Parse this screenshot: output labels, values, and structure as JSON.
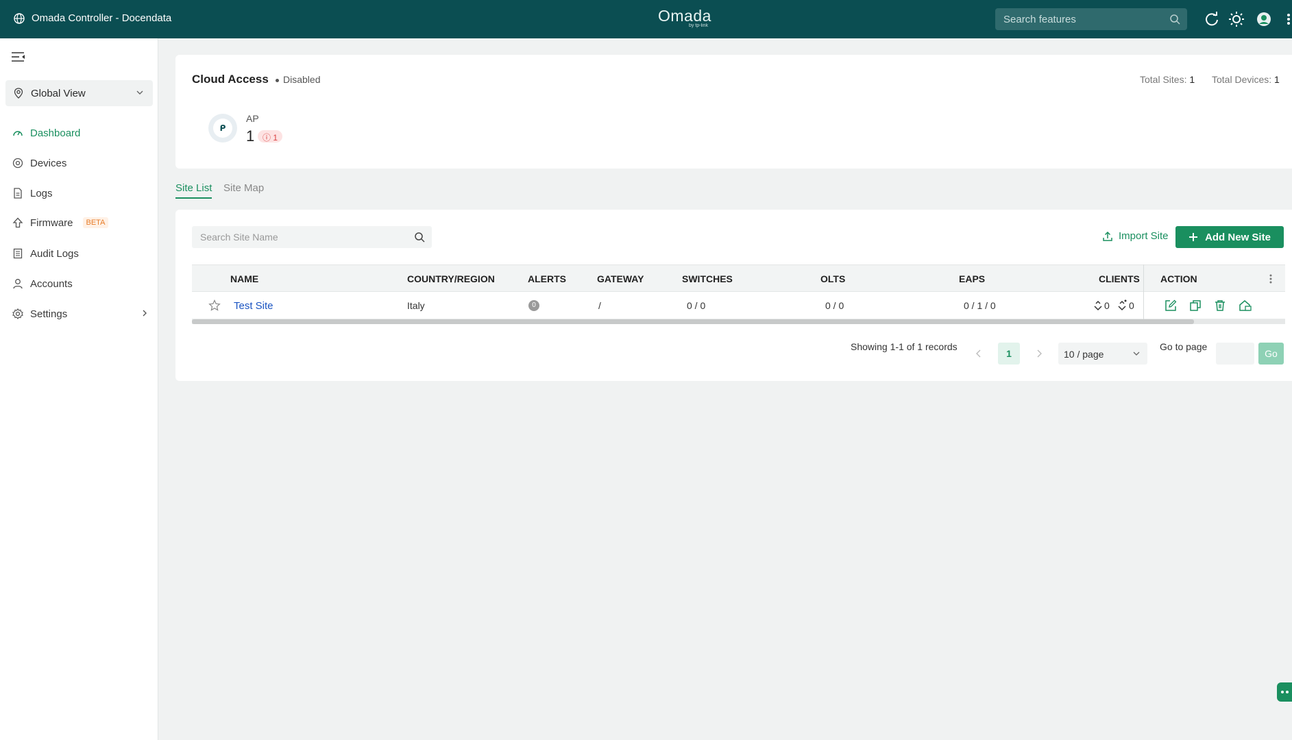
{
  "topbar": {
    "title": "Omada Controller - Docendata",
    "logo": "Omada",
    "logo_sub": "by tp-link",
    "search_placeholder": "Search features"
  },
  "sidebar": {
    "global_view": "Global View",
    "items": [
      {
        "label": "Dashboard",
        "icon": "dashboard-icon",
        "active": true
      },
      {
        "label": "Devices",
        "icon": "devices-icon"
      },
      {
        "label": "Logs",
        "icon": "logs-icon"
      },
      {
        "label": "Firmware",
        "icon": "firmware-icon",
        "badge": "BETA"
      },
      {
        "label": "Audit Logs",
        "icon": "audit-logs-icon"
      },
      {
        "label": "Accounts",
        "icon": "accounts-icon"
      },
      {
        "label": "Settings",
        "icon": "settings-icon",
        "has_submenu": true
      }
    ]
  },
  "cloud": {
    "title": "Cloud Access",
    "status": "Disabled",
    "total_sites_label": "Total Sites:",
    "total_sites": "1",
    "total_devices_label": "Total Devices:",
    "total_devices": "1",
    "ap_label": "AP",
    "ap_count": "1",
    "ap_alert": "1"
  },
  "tabs": [
    "Site List",
    "Site Map"
  ],
  "sitelist": {
    "search_placeholder": "Search Site Name",
    "import_label": "Import Site",
    "add_label": "Add New Site",
    "columns": [
      "NAME",
      "COUNTRY/REGION",
      "ALERTS",
      "GATEWAY",
      "SWITCHES",
      "OLTS",
      "EAPS",
      "CLIENTS",
      "ACTION"
    ],
    "rows": [
      {
        "name": "Test Site",
        "country": "Italy",
        "alerts": "0",
        "gateway": "/",
        "switches": "0 / 0",
        "olts": "0 / 0",
        "eaps": "0 / 1 / 0",
        "clients_wired": "0",
        "clients_wireless": "0"
      }
    ]
  },
  "pagination": {
    "summary": "Showing 1-1 of 1 records",
    "current": "1",
    "per_page": "10 / page",
    "goto_label": "Go to page",
    "go_button": "Go"
  },
  "colors": {
    "accent": "#1a8f5f",
    "header": "#0b4e52",
    "link": "#1a54c2"
  }
}
